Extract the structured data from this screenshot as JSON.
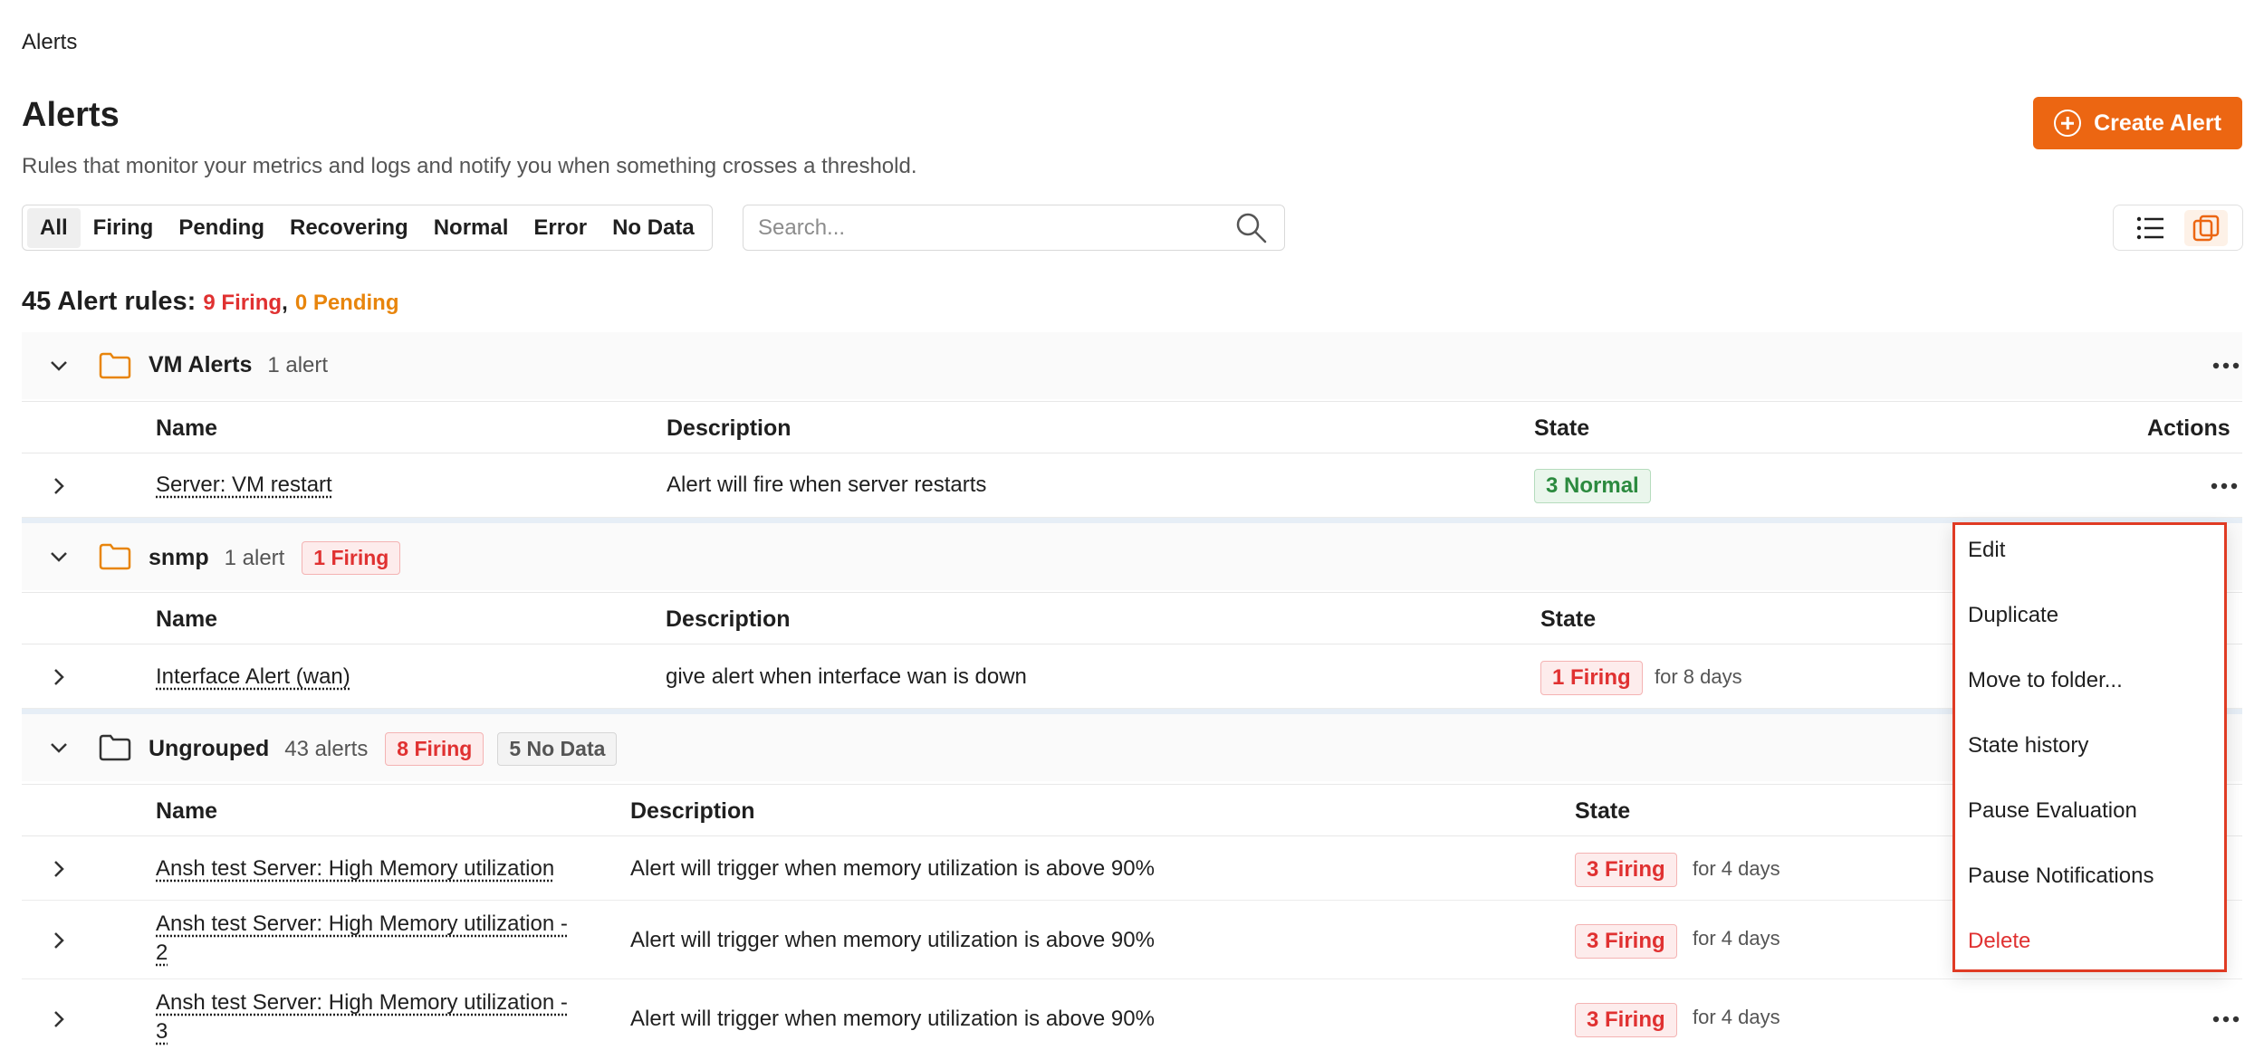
{
  "breadcrumb": "Alerts",
  "page": {
    "title": "Alerts",
    "subtitle": "Rules that monitor your metrics and logs and notify you when something crosses a threshold.",
    "create_button": "Create Alert"
  },
  "filters": {
    "tabs": [
      "All",
      "Firing",
      "Pending",
      "Recovering",
      "Normal",
      "Error",
      "No Data"
    ],
    "active": "All"
  },
  "search": {
    "placeholder": "Search..."
  },
  "view_toggle": {
    "active": "grouped"
  },
  "summary": {
    "label": "45 Alert rules:",
    "firing": "9 Firing",
    "comma": ",",
    "pending": "0 Pending"
  },
  "columns": {
    "name": "Name",
    "description": "Description",
    "state": "State",
    "actions": "Actions"
  },
  "groups": [
    {
      "name": "VM Alerts",
      "count": "1 alert",
      "badges": [],
      "rows": [
        {
          "name": "Server: VM restart",
          "description": "Alert will fire when server restarts",
          "state": "3 Normal",
          "duration": ""
        }
      ]
    },
    {
      "name": "snmp",
      "count": "1 alert",
      "badges": [
        "1 Firing"
      ],
      "rows": [
        {
          "name": "Interface Alert (wan)",
          "description": "give alert when interface wan is down",
          "state": "1 Firing",
          "duration": "for 8 days"
        }
      ]
    },
    {
      "name": "Ungrouped",
      "count": "43 alerts",
      "badges": [
        "8 Firing",
        "5 No Data"
      ],
      "rows": [
        {
          "name": "Ansh test Server: High Memory utilization",
          "description": "Alert will trigger when memory utilization is above 90%",
          "state": "3 Firing",
          "duration": "for 4 days"
        },
        {
          "name_line1": "Ansh test Server: High Memory utilization -",
          "name_line2": "2",
          "description": "Alert will trigger when memory utilization is above 90%",
          "state": "3 Firing",
          "duration": "for 4 days"
        },
        {
          "name_line1": "Ansh test Server: High Memory utilization -",
          "name_line2": "3",
          "description": "Alert will trigger when memory utilization is above 90%",
          "state": "3 Firing",
          "duration": "for 4 days"
        }
      ]
    }
  ],
  "context_menu": {
    "items": [
      "Edit",
      "Duplicate",
      "Move to folder...",
      "State history",
      "Pause Evaluation",
      "Pause Notifications",
      "Delete"
    ]
  },
  "colors": {
    "accent": "#ec6612",
    "firing": "#e03131",
    "pending": "#e8850c",
    "normal": "#2b8a3e",
    "menu_border": "#e03b24"
  }
}
